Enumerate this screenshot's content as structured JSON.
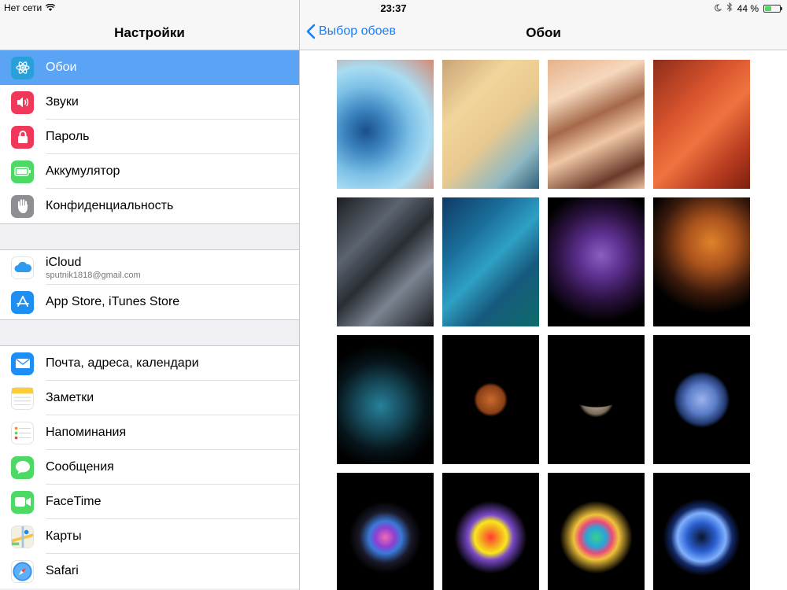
{
  "status": {
    "carrier": "Нет сети",
    "time": "23:37",
    "battery_percent": "44 %",
    "battery_level": 0.44
  },
  "master": {
    "title": "Настройки",
    "groups": [
      {
        "items": [
          {
            "label": "Обои",
            "icon": "wallpaper-icon",
            "color": "#2aa0da",
            "selected": true
          },
          {
            "label": "Звуки",
            "icon": "speaker-icon",
            "color": "#f0395a"
          },
          {
            "label": "Пароль",
            "icon": "lock-icon",
            "color": "#f0395a"
          },
          {
            "label": "Аккумулятор",
            "icon": "battery-icon",
            "color": "#4cd964"
          },
          {
            "label": "Конфиденциальность",
            "icon": "hand-icon",
            "color": "#8e8e93"
          }
        ]
      },
      {
        "items": [
          {
            "label": "iCloud",
            "sub": "sputnik1818@gmail.com",
            "icon": "cloud-icon",
            "color": "#ffffff"
          },
          {
            "label": "App Store, iTunes Store",
            "icon": "app-store-icon",
            "color": "#1f8ef1"
          }
        ]
      },
      {
        "items": [
          {
            "label": "Почта, адреса, календари",
            "icon": "mail-icon",
            "color": "#1d8ef5"
          },
          {
            "label": "Заметки",
            "icon": "notes-icon",
            "color": "#ffffff"
          },
          {
            "label": "Напоминания",
            "icon": "reminders-icon",
            "color": "#ffffff"
          },
          {
            "label": "Сообщения",
            "icon": "messages-icon",
            "color": "#4cd964"
          },
          {
            "label": "FaceTime",
            "icon": "facetime-icon",
            "color": "#4cd964"
          },
          {
            "label": "Карты",
            "icon": "maps-icon",
            "color": "#ffffff"
          },
          {
            "label": "Safari",
            "icon": "safari-icon",
            "color": "#ffffff"
          }
        ]
      }
    ]
  },
  "detail": {
    "back_label": "Выбор обоев",
    "title": "Обои",
    "wallpapers": [
      {
        "name": "wallpaper-blue-water",
        "bg": "radial-gradient(circle at 30% 55%, #1a4f8a 0%, #3c85c0 22%, #7cc0e6 45%, #a9dcf2 65%, #d58a73 100%)"
      },
      {
        "name": "wallpaper-sand-yellow",
        "bg": "linear-gradient(135deg, #c8a478 0%, #f1d59b 30%, #e9c98e 55%, #8eb8c2 80%, #2f5e78 100%)"
      },
      {
        "name": "wallpaper-desert-dunes",
        "bg": "linear-gradient(155deg, #e6b28a 0%, #f6d8bd 25%, #a5694a 45%, #f0c7a5 62%, #6b3a2a 85%, #ecc0a0 100%)"
      },
      {
        "name": "wallpaper-red-feathers",
        "bg": "linear-gradient(135deg, #8e2d1b 0%, #d8542d 35%, #f0733f 55%, #b53a1e 80%, #7a1e10 100%)"
      },
      {
        "name": "wallpaper-grey-feathers",
        "bg": "linear-gradient(135deg, #1c1e22 0%, #5b6470 30%, #2a2d33 50%, #7a8491 70%, #1a1b1f 100%)"
      },
      {
        "name": "wallpaper-teal-feathers",
        "bg": "linear-gradient(135deg, #0e3a63 0%, #1b6f9c 30%, #2fa0c4 50%, #175a7e 70%, #0d6b6a 100%)"
      },
      {
        "name": "wallpaper-purple-flower",
        "bg": "radial-gradient(circle at 55% 45%, #8a5fc2 0%, #5b2f8e 25%, #2b1240 50%, #000 75%)"
      },
      {
        "name": "wallpaper-orange-foliage",
        "bg": "radial-gradient(circle at 60% 35%, #e0822b 0%, #a9521c 25%, #3a1a0c 50%, #000 70%)"
      },
      {
        "name": "wallpaper-dark-teal-leaves",
        "bg": "radial-gradient(circle at 45% 55%, #27819b 0%, #174d5e 25%, #07151a 50%, #000 70%)"
      },
      {
        "name": "wallpaper-mars",
        "bg": "radial-gradient(circle at 50% 50%, #c86b2c 0%, #8a3f18 17%, #000 21%)"
      },
      {
        "name": "wallpaper-crescent-moon",
        "bg": "radial-gradient(ellipse 38px 20px at 50% 44%, #000 0%, #000 95%, transparent 100%), radial-gradient(circle at 50% 50%, #d8c5b2 0%, #7a6b5c 18%, #000 22%)"
      },
      {
        "name": "wallpaper-neptune",
        "bg": "radial-gradient(circle at 50% 50%, #9ab4ec 0%, #5b7cc8 18%, #22396f 30%, #000 35%)"
      },
      {
        "name": "wallpaper-color-burst-pink",
        "bg": "radial-gradient(circle at 50% 50%, #f16bb5 0%, #8d3fd1 12%, #3a7ad9 20%, #1a1a2a 32%, #000 45%)"
      },
      {
        "name": "wallpaper-color-burst-yellow",
        "bg": "radial-gradient(circle at 50% 50%, #ff3b30 0%, #f5a623 12%, #f8e71c 20%, #7a4ac9 28%, #000 45%)"
      },
      {
        "name": "wallpaper-color-burst-green",
        "bg": "radial-gradient(circle at 50% 50%, #39d28b 0%, #2aa4d9 12%, #e94b7a 20%, #f0c23a 28%, #000 45%)"
      },
      {
        "name": "wallpaper-blue-sphere-burst",
        "bg": "radial-gradient(circle at 50% 50%, #0a1430 0%, #2b5fd1 18%, #7fb0ff 30%, #142a6a 38%, #000 48%)"
      }
    ]
  }
}
